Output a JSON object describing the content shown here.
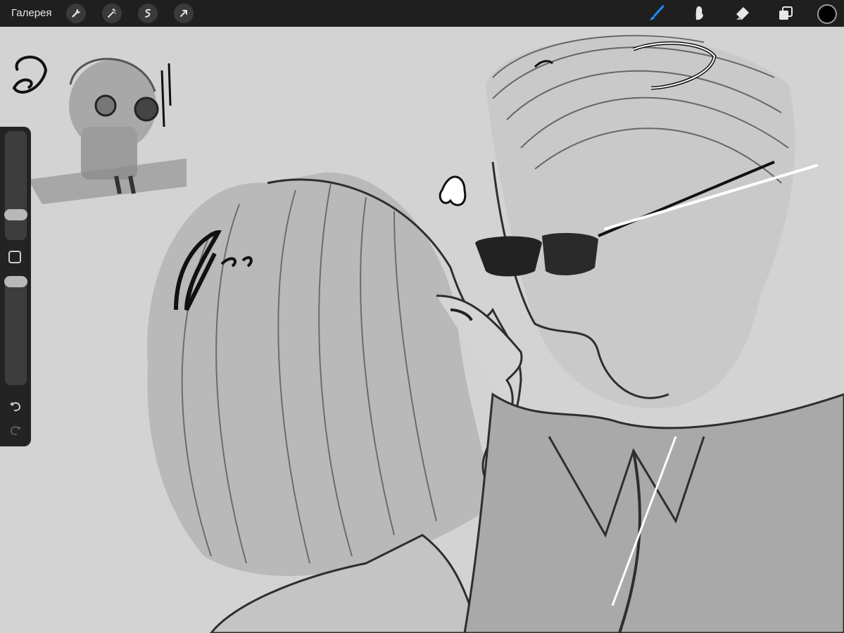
{
  "app": {
    "gallery_label": "Галерея",
    "active_color": "#000000",
    "accent_color": "#1e8cff"
  },
  "toolbar": {
    "left_tools": [
      "wrench-icon",
      "magic-wand-icon",
      "selection-icon",
      "transform-arrow-icon"
    ],
    "right_tools": [
      "brush-icon",
      "smudge-icon",
      "eraser-icon",
      "layers-icon"
    ],
    "active_tool": "brush-icon"
  },
  "sidebar": {
    "brush_size": 0.2,
    "opacity": 1.0
  }
}
